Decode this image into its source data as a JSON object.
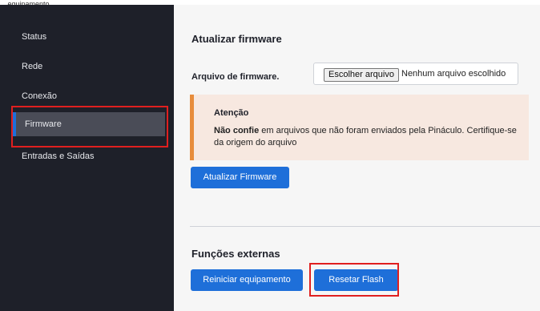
{
  "topbar": {
    "partial_text": "...equipamento..."
  },
  "sidebar": {
    "items": [
      {
        "label": "Status"
      },
      {
        "label": "Rede"
      },
      {
        "label": "Conexão"
      },
      {
        "label": "Firmware"
      },
      {
        "label": "Entradas e Saídas"
      }
    ],
    "active_index": 3
  },
  "firmware": {
    "title": "Atualizar firmware",
    "file_label": "Arquivo de firmware.",
    "file_button": "Escolher arquivo",
    "file_status": "Nenhum arquivo escolhido",
    "alert_title": "Atenção",
    "alert_bold": "Não confie",
    "alert_text": " em arquivos que não foram enviados pela Pináculo. Certifique-se da origem do arquivo",
    "update_button": "Atualizar Firmware"
  },
  "external": {
    "title": "Funções externas",
    "restart_button": "Reiniciar equipamento",
    "reset_flash_button": "Resetar Flash"
  },
  "colors": {
    "sidebar_bg": "#1e2029",
    "primary": "#1e6fd9",
    "alert_bg": "#f7e8e0",
    "alert_border": "#e78c3b",
    "highlight": "#e01f1f"
  }
}
